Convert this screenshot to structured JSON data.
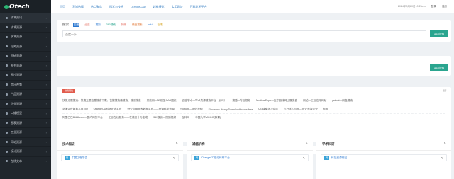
{
  "logo": {
    "text": "Otech"
  },
  "sidebar": {
    "items": [
      {
        "label": "技术资讯"
      },
      {
        "label": "技术资源"
      },
      {
        "label": "学术资源"
      },
      {
        "label": "导师资源"
      },
      {
        "label": "科研资源"
      },
      {
        "label": "图书资源"
      },
      {
        "label": "图片资源"
      },
      {
        "label": "音乐视频"
      },
      {
        "label": "产品资源"
      },
      {
        "label": "企业资源"
      },
      {
        "label": "二维模型"
      },
      {
        "label": "图表资源"
      },
      {
        "label": "工业资源"
      },
      {
        "label": "网站资源"
      },
      {
        "label": "设计资源"
      },
      {
        "label": "在线文本"
      }
    ]
  },
  "topnav": {
    "links": [
      "首页",
      "我知热搜",
      "热点聚焦",
      "科学与技术",
      "OrangeCAD",
      "超链接学",
      "实用网址",
      "百科学术平台"
    ]
  },
  "topright": {
    "time": "2024年8月20日10:25am",
    "login": "登录",
    "register": "注册"
  },
  "search": {
    "label": "搜索",
    "engines": [
      "百度",
      "必应",
      "搜狗",
      "360搜索",
      "知乎",
      "微信搜索",
      "wiki",
      "谷歌"
    ],
    "placeholder": "百度一下",
    "button": "站内搜索"
  },
  "translate": {
    "button": "站内搜索"
  },
  "links": {
    "badge": "常用网站",
    "more": "更多",
    "rows": [
      [
        "快搜无限搜索、快搜无限信息搜索下载、快搜搜索高搜索、搜无搜索",
        "开放网—3D模型CAD图纸",
        "百度学术—学术资源搜索平台（公司）",
        "搜狐—专业视频",
        "MedicalExpo—医疗器械网上展览会",
        "网站—工业应用网站",
        "patent—网盘搜索"
      ],
      [
        "学海泛舟数据平台.pdf",
        "OrangeCD科研设计平台",
        "野火应用网大数据平台——开源科学资源",
        "Youtube—国外视频",
        "Electronic library,Download books free",
        "UG建模学习论坛",
        "扎兴学习与网—设计资源大全",
        "知网"
      ],
      [
        "阿里巴巴1688.com—国内网货平台",
        "工业在线服务——在线设计与生成",
        "360视频—搜狐视频",
        "百科网",
        "中国大学MOOC(慕课)"
      ]
    ]
  },
  "bottom": {
    "badge": "精选网站",
    "tip": "提供以下精选专栏等各类资源信息，欢迎各位分享"
  },
  "panels": [
    {
      "title": "技术知识",
      "tag": "网",
      "item": "中国工程学会"
    },
    {
      "title": "减缩机构",
      "tag": "网",
      "item": "OrangeCD在线科研平台"
    },
    {
      "title": "学术科研",
      "tag": "网",
      "item": "科技资源网站"
    }
  ],
  "colors": {
    "sidebar": "#20262c",
    "accent": "#2a77d0",
    "button": "#2aa58f",
    "badge": "#e15b4c"
  }
}
